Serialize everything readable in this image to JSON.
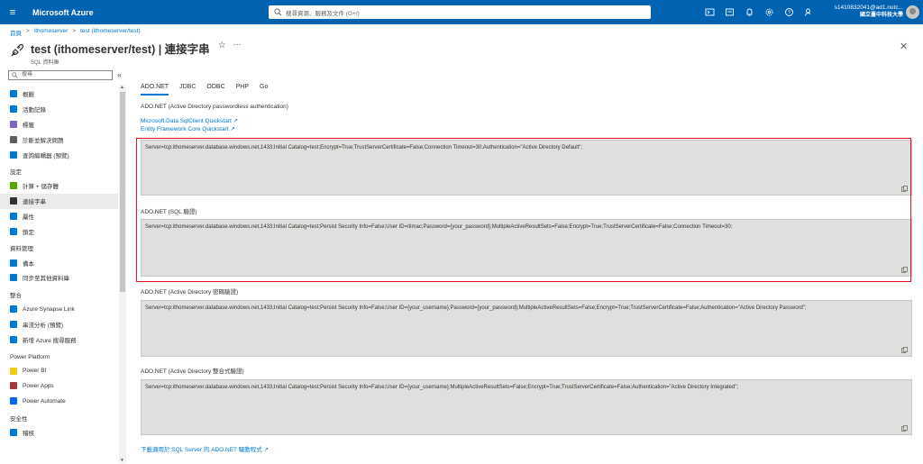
{
  "topbar": {
    "brand": "Microsoft Azure",
    "search_placeholder": "搜尋資源、服務及文件 (G+/)",
    "user_email": "s1410832041@ad1.nutc...",
    "user_org": "國立臺中科技大學"
  },
  "breadcrumb": [
    "首頁",
    "ithomeserver",
    "test (ithomeserver/test)"
  ],
  "title": {
    "main": "test (ithomeserver/test) | 連接字串",
    "subtitle": "SQL 資料庫"
  },
  "sidebar": {
    "search_placeholder": "搜尋",
    "collapse_glyph": "«",
    "items": [
      {
        "type": "item",
        "label": "概觀",
        "icon": "overview-icon",
        "color": "#0078d4"
      },
      {
        "type": "item",
        "label": "活動記錄",
        "icon": "activity-log-icon",
        "color": "#0078d4"
      },
      {
        "type": "item",
        "label": "標籤",
        "icon": "tag-icon",
        "color": "#8661c5"
      },
      {
        "type": "item",
        "label": "診斷並解決問題",
        "icon": "wrench-icon",
        "color": "#605e5c"
      },
      {
        "type": "item",
        "label": "查詢編輯器 (預覽)",
        "icon": "query-editor-icon",
        "color": "#0078d4"
      },
      {
        "type": "section",
        "label": "設定"
      },
      {
        "type": "item",
        "label": "計算 + 儲存體",
        "icon": "compute-storage-icon",
        "color": "#57a300"
      },
      {
        "type": "item",
        "label": "連接字串",
        "icon": "connection-strings-icon",
        "color": "#323130",
        "active": true
      },
      {
        "type": "item",
        "label": "屬性",
        "icon": "properties-icon",
        "color": "#0078d4"
      },
      {
        "type": "item",
        "label": "鎖定",
        "icon": "lock-icon",
        "color": "#0078d4"
      },
      {
        "type": "section",
        "label": "資料管理"
      },
      {
        "type": "item",
        "label": "備本",
        "icon": "replicas-icon",
        "color": "#0078d4"
      },
      {
        "type": "item",
        "label": "同步至其他資料庫",
        "icon": "sync-icon",
        "color": "#0078d4"
      },
      {
        "type": "section",
        "label": "整合"
      },
      {
        "type": "item",
        "label": "Azure Synapse Link",
        "icon": "synapse-link-icon",
        "color": "#0078d4"
      },
      {
        "type": "item",
        "label": "串流分析 (預覽)",
        "icon": "stream-analytics-icon",
        "color": "#0078d4"
      },
      {
        "type": "item",
        "label": "新增 Azure 搜尋服務",
        "icon": "search-service-icon",
        "color": "#0078d4"
      },
      {
        "type": "section",
        "label": "Power Platform"
      },
      {
        "type": "item",
        "label": "Power BI",
        "icon": "power-bi-icon",
        "color": "#f2c811"
      },
      {
        "type": "item",
        "label": "Power Apps",
        "icon": "power-apps-icon",
        "color": "#a4373a"
      },
      {
        "type": "item",
        "label": "Power Automate",
        "icon": "power-automate-icon",
        "color": "#0066ff"
      },
      {
        "type": "section",
        "label": "安全性"
      },
      {
        "type": "item",
        "label": "稽核",
        "icon": "auditing-icon",
        "color": "#0078d4"
      }
    ]
  },
  "tabs": [
    {
      "label": "ADO.NET",
      "active": true
    },
    {
      "label": "JDBC"
    },
    {
      "label": "ODBC"
    },
    {
      "label": "PHP"
    },
    {
      "label": "Go"
    }
  ],
  "content": {
    "section1_label": "ADO.NET (Active Directory passwordless authentication)",
    "link1": "Microsoft.Data.SqlClient Quickstart",
    "link2": "Entity Framework Core Quickstart",
    "box1": "Server=tcp:ithomeserver.database.windows.net,1433;Initial Catalog=test;Encrypt=True;TrustServerCertificate=False;Connection Timeout=30;Authentication=\"Active Directory Default\";",
    "section2_label": "ADO.NET (SQL 驗證)",
    "box2": "Server=tcp:ithomeserver.database.windows.net,1433;Initial Catalog=test;Persist Security Info=False;User ID=itimac;Password={your_password};MultipleActiveResultSets=False;Encrypt=True;TrustServerCertificate=False;Connection Timeout=30;",
    "section3_label": "ADO.NET (Active Directory 密碼驗證)",
    "box3": "Server=tcp:ithomeserver.database.windows.net,1433;Initial Catalog=test;Persist Security Info=False;User ID={your_username};Password={your_password};MultipleActiveResultSets=False;Encrypt=True;TrustServerCertificate=False;Authentication=\"Active Directory Password\";",
    "section4_label": "ADO.NET (Active Directory 整合式驗證)",
    "box4": "Server=tcp:ithomeserver.database.windows.net,1433;Initial Catalog=test;Persist Security Info=False;User ID={your_username};MultipleActiveResultSets=False;Encrypt=True;TrustServerCertificate=False;Authentication=\"Active Directory Integrated\";",
    "bottom_link": "下載適用於 SQL Server 的 ADO.NET 驅動程式"
  },
  "colors": {
    "topbar": "#0063b1",
    "accent": "#0078d4",
    "highlight": "#e81123"
  }
}
